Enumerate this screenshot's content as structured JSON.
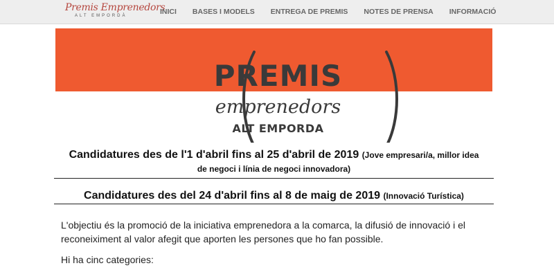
{
  "nav": {
    "logo_text": "Premis Emprenedors",
    "logo_sub": "ALT EMPORDÀ",
    "items": [
      {
        "label": "INICI"
      },
      {
        "label": "BASES I MODELS"
      },
      {
        "label": "ENTREGA DE PREMIS"
      },
      {
        "label": "NOTES DE PRENSA"
      },
      {
        "label": "INFORMACIÓ"
      }
    ]
  },
  "banner": {
    "title": "PREMIS",
    "subtitle": "emprenedors",
    "region": "ALT EMPORDA",
    "colors": {
      "orange": "#ef5a30",
      "text": "#3a3a3a"
    }
  },
  "headings": {
    "h1_main": "Candidatures des de l'1 d'abril fins al 25 d'abril de 2019",
    "h1_note_a": "(Jove empresari/a, millor idea",
    "h1_note_b": "de negoci i línia de negoci innovadora)",
    "h2_main": "Candidatures des del 24 d'abril fins al 8 de maig de 2019",
    "h2_note": "(Innovació Turística)"
  },
  "body": {
    "p1_line1": "L'objectiu és la promoció de la iniciativa emprenedora a la comarca, la difusió de innovació i el",
    "p1_line2": "reconeiximent al valor afegit que aporten les persones que ho fan possible.",
    "p2": "Hi ha cinc categories:"
  }
}
